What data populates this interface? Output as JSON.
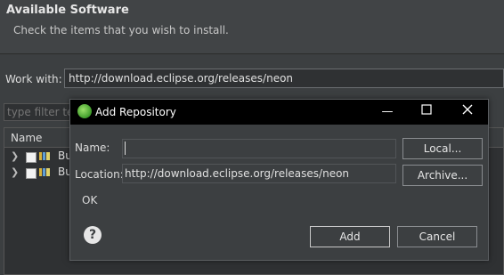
{
  "wizard": {
    "title": "Available Software",
    "description": "Check the items that you wish to install.",
    "work_with_label": "Work with:",
    "work_with_value": "http://download.eclipse.org/releases/neon",
    "filter_placeholder": "type filter te",
    "tree_header": "Name",
    "tree_rows": [
      {
        "label": "Bu"
      },
      {
        "label": "Bu"
      }
    ]
  },
  "dialog": {
    "title": "Add Repository",
    "name_label": "Name:",
    "name_value": "",
    "location_label": "Location:",
    "location_value": "http://download.eclipse.org/releases/neon",
    "local_button": "Local...",
    "archive_button": "Archive...",
    "status_text": "OK",
    "add_button": "Add",
    "cancel_button": "Cancel",
    "help_glyph": "?",
    "icons": {
      "app": "eclipse-app-icon",
      "minimize": "minimize-icon",
      "maximize": "maximize-icon",
      "close": "close-icon",
      "help": "help-icon"
    }
  },
  "colors": {
    "background": "#3c3f41",
    "titlebar": "#000000"
  }
}
